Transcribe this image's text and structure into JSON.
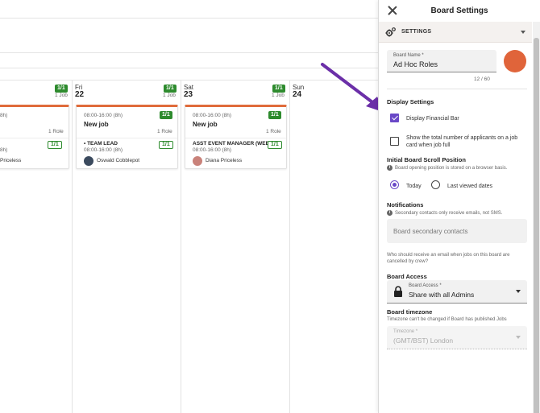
{
  "board": {
    "days": [
      {
        "day_name": "",
        "day_num": "",
        "badge": "1/1",
        "jobs_count": "1 Job",
        "card": {
          "time": "8h)",
          "roles": "1 Role",
          "role_badge": "1/1",
          "role_time": "8h)",
          "person": "Priceless"
        }
      },
      {
        "day_name": "Fri",
        "day_num": "22",
        "badge": "1/1",
        "jobs_count": "1 Job",
        "card": {
          "time": "08:00-16:00 (8h)",
          "badge": "1/1",
          "title": "New job",
          "roles": "1 Role",
          "role_name": "• TEAM LEAD",
          "role_badge": "1/1",
          "role_time": "08:00-16:00 (8h)",
          "person": "Oswald Cobblepot"
        }
      },
      {
        "day_name": "Sat",
        "day_num": "23",
        "badge": "1/1",
        "jobs_count": "1 Job",
        "card": {
          "time": "08:00-16:00 (8h)",
          "badge": "1/1",
          "title": "New job",
          "roles": "1 Role",
          "role_name": "ASST EVENT MANAGER (WEEK...",
          "role_badge": "1/1",
          "role_time": "08:00-16:00 (8h)",
          "person": "Diana Priceless"
        }
      },
      {
        "day_name": "Sun",
        "day_num": "24"
      }
    ]
  },
  "panel": {
    "title": "Board Settings",
    "section_label": "SETTINGS",
    "board_name_label": "Board Name *",
    "board_name_value": "Ad Hoc Roles",
    "char_count": "12 / 60",
    "accent_color": "#e0643a",
    "display_settings": {
      "title": "Display Settings",
      "financial_bar_label": "Display Financial Bar",
      "financial_bar_checked": true,
      "applicants_label": "Show the total number of applicants on a job card when job full",
      "applicants_checked": false
    },
    "scroll_position": {
      "title": "Initial Board Scroll Position",
      "info": "Board opening position is stored on a browser basis.",
      "option_today": "Today",
      "option_last": "Last viewed dates",
      "selected": "Today"
    },
    "notifications": {
      "title": "Notifications",
      "info": "Secondary contacts only receive emails, not SMS.",
      "placeholder": "Board secondary contacts",
      "help": "Who should receive an email when jobs on this board are cancelled by crew?"
    },
    "board_access": {
      "title": "Board Access",
      "label": "Board Access *",
      "value": "Share with all Admins"
    },
    "timezone": {
      "title": "Board timezone",
      "info": "Timezone can't be changed if Board has published Jobs",
      "label": "Timezone *",
      "value": "(GMT/BST) London"
    }
  },
  "colors": {
    "brand_purple": "#6a48c7",
    "badge_green": "#2e8b2e",
    "card_accent": "#e06b3b",
    "arrow": "#6b2fa8"
  }
}
